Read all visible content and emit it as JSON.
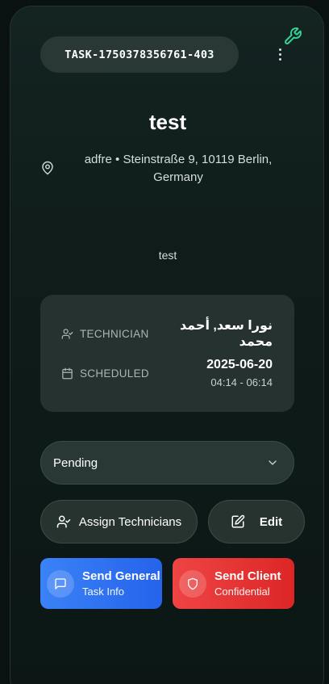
{
  "header": {
    "task_id": "TASK-1750378356761-403",
    "wrench_icon": "wrench-icon",
    "menu_icon": "more-vertical-icon"
  },
  "task": {
    "title": "test",
    "address": "adfre • Steinstraße 9, 10119 Berlin, Germany",
    "description": "test"
  },
  "details": {
    "technician_label": "TECHNICIAN",
    "technician_value": "نورا سعد, أحمد محمد",
    "scheduled_label": "SCHEDULED",
    "scheduled_date": "2025-06-20",
    "scheduled_time": "04:14 - 06:14"
  },
  "status": {
    "selected": "Pending"
  },
  "actions": {
    "assign_label": "Assign Technicians",
    "edit_label": "Edit",
    "send_general_title": "Send General",
    "send_general_sub": "Task Info",
    "send_client_title": "Send Client",
    "send_client_sub": "Confidential"
  },
  "colors": {
    "accent_green": "#34d399",
    "general_blue": "#3b82f6",
    "client_red": "#ef4444"
  }
}
